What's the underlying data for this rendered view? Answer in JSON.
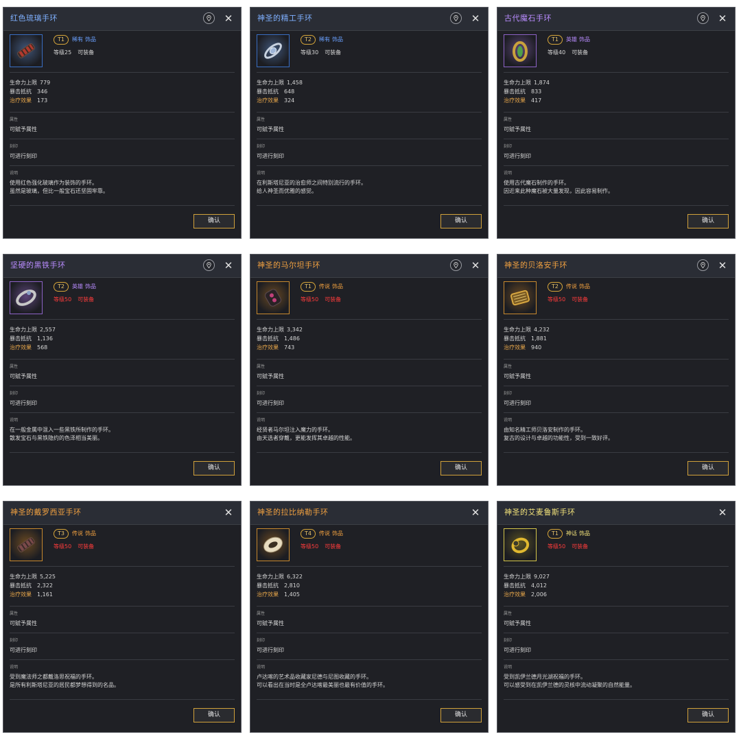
{
  "labels": {
    "hp": "生命力上限",
    "crit": "暴击抵抗",
    "heal": "治疗效果",
    "attr_head": "属性",
    "attr_body": "可赋予属性",
    "engrave_head": "刻印",
    "engrave_body": "可进行刻印",
    "desc_head": "说明",
    "confirm": "确认",
    "equippable": "可装备",
    "category": "饰品"
  },
  "cards": [
    {
      "title": "红色琉璃手环",
      "title_color": "#7fb0ff",
      "tier": "T1",
      "rarity": "稀有",
      "rarity_color": "#6aa0ff",
      "level": "等级25",
      "level_red": false,
      "hp": "779",
      "crit": "346",
      "heal": "173",
      "desc1": "使用红色强化玻璃作为装饰的手环。",
      "desc2": "虽然是玻璃，但比一般宝石还坚固牢靠。",
      "pinned": true,
      "icon": "chain-bracelet-icon",
      "frame": "#3a6fc4",
      "glow": "#3f5578",
      "gem": "#b03a2e"
    },
    {
      "title": "神圣的精工手环",
      "title_color": "#7fb0ff",
      "tier": "T2",
      "rarity": "稀有",
      "rarity_color": "#6aa0ff",
      "level": "等级30",
      "level_red": false,
      "hp": "1,458",
      "crit": "648",
      "heal": "324",
      "desc1": "在利斯塔尼亚的治愈师之间特别流行的手环。",
      "desc2": "给人神圣而优雅的感觉。",
      "pinned": true,
      "icon": "silver-bracelet-icon",
      "frame": "#3a6fc4",
      "glow": "#3f5578",
      "gem": "#9fb6d8"
    },
    {
      "title": "古代魔石手环",
      "title_color": "#b98cff",
      "tier": "T1",
      "rarity": "英雄",
      "rarity_color": "#b98cff",
      "level": "等级40",
      "level_red": false,
      "hp": "1,874",
      "crit": "833",
      "heal": "417",
      "desc1": "使用古代魔石制作的手环。",
      "desc2": "因近来此种魔石被大量发现，因此容易制作。",
      "pinned": true,
      "icon": "gem-ring-icon",
      "frame": "#8e63c8",
      "glow": "#5b4478",
      "gem": "#4fa04a"
    },
    {
      "title": "坚硬的黑铁手环",
      "title_color": "#b98cff",
      "tier": "T2",
      "rarity": "英雄",
      "rarity_color": "#b98cff",
      "level": "等级50",
      "level_red": true,
      "hp": "2,557",
      "crit": "1,136",
      "heal": "568",
      "desc1": "在一般金属中混入一些黑铁所制作的手环。",
      "desc2": "散发宝石与黑铁隐约的色泽相当美丽。",
      "pinned": true,
      "icon": "iron-bracelet-icon",
      "frame": "#8e63c8",
      "glow": "#5b4478",
      "gem": "#c8c8c8"
    },
    {
      "title": "神圣的马尔坦手环",
      "title_color": "#f0a040",
      "tier": "T1",
      "rarity": "传说",
      "rarity_color": "#f0a040",
      "level": "等级50",
      "level_red": true,
      "hp": "3,342",
      "crit": "1,486",
      "heal": "743",
      "desc1": "经贤者马尔坦注入魔力的手环。",
      "desc2": "由天选者穿戴，更能发挥其卓越的性能。",
      "pinned": true,
      "icon": "dark-bracelet-icon",
      "frame": "#c98a2e",
      "glow": "#6b4a22",
      "gem": "#c0407a"
    },
    {
      "title": "神圣的贝洛安手环",
      "title_color": "#f0a040",
      "tier": "T2",
      "rarity": "传说",
      "rarity_color": "#f0a040",
      "level": "等级50",
      "level_red": true,
      "hp": "4,232",
      "crit": "1,881",
      "heal": "940",
      "desc1": "由知名精工师贝洛安制作的手环。",
      "desc2": "复古的设计与卓越的功能性，受到一致好评。",
      "pinned": true,
      "icon": "gold-cuff-icon",
      "frame": "#c98a2e",
      "glow": "#6b4a22",
      "gem": "#d8a740"
    },
    {
      "title": "神圣的戴罗西亚手环",
      "title_color": "#f0a040",
      "tier": "T3",
      "rarity": "传说",
      "rarity_color": "#f0a040",
      "level": "等级50",
      "level_red": true,
      "hp": "5,225",
      "crit": "2,322",
      "heal": "1,161",
      "desc1": "受到魔法师之都戴洛思祝福的手环。",
      "desc2": "是所有利斯塔尼亚的居民都梦想得到的名品。",
      "pinned": false,
      "icon": "chain-bracelet-icon",
      "frame": "#c98a2e",
      "glow": "#6b4a22",
      "gem": "#7a4a4a"
    },
    {
      "title": "神圣的拉比纳勒手环",
      "title_color": "#f0a040",
      "tier": "T4",
      "rarity": "传说",
      "rarity_color": "#f0a040",
      "level": "等级50",
      "level_red": true,
      "hp": "6,322",
      "crit": "2,810",
      "heal": "1,405",
      "desc1": "卢达喀的艺术品收藏家尼德与尼图收藏的手环。",
      "desc2": "可以看出在当时是全卢达喀最美丽也最有价值的手环。",
      "pinned": false,
      "icon": "ornate-bracelet-icon",
      "frame": "#c98a2e",
      "glow": "#6b4a22",
      "gem": "#e8dcc0"
    },
    {
      "title": "神圣的艾麦鲁斯手环",
      "title_color": "#f2e27a",
      "tier": "T1",
      "rarity": "神话",
      "rarity_color": "#f2e27a",
      "level": "等级50",
      "level_red": true,
      "hp": "9,027",
      "crit": "4,012",
      "heal": "2,006",
      "desc1": "受到凯伊兰德月光湖祝福的手环。",
      "desc2": "可以感受到在凯伊兰德的灵核中流动凝聚的自然能量。",
      "pinned": false,
      "icon": "gold-ring-icon",
      "frame": "#d6c74a",
      "glow": "#5a5222",
      "gem": "#e0b830"
    }
  ]
}
